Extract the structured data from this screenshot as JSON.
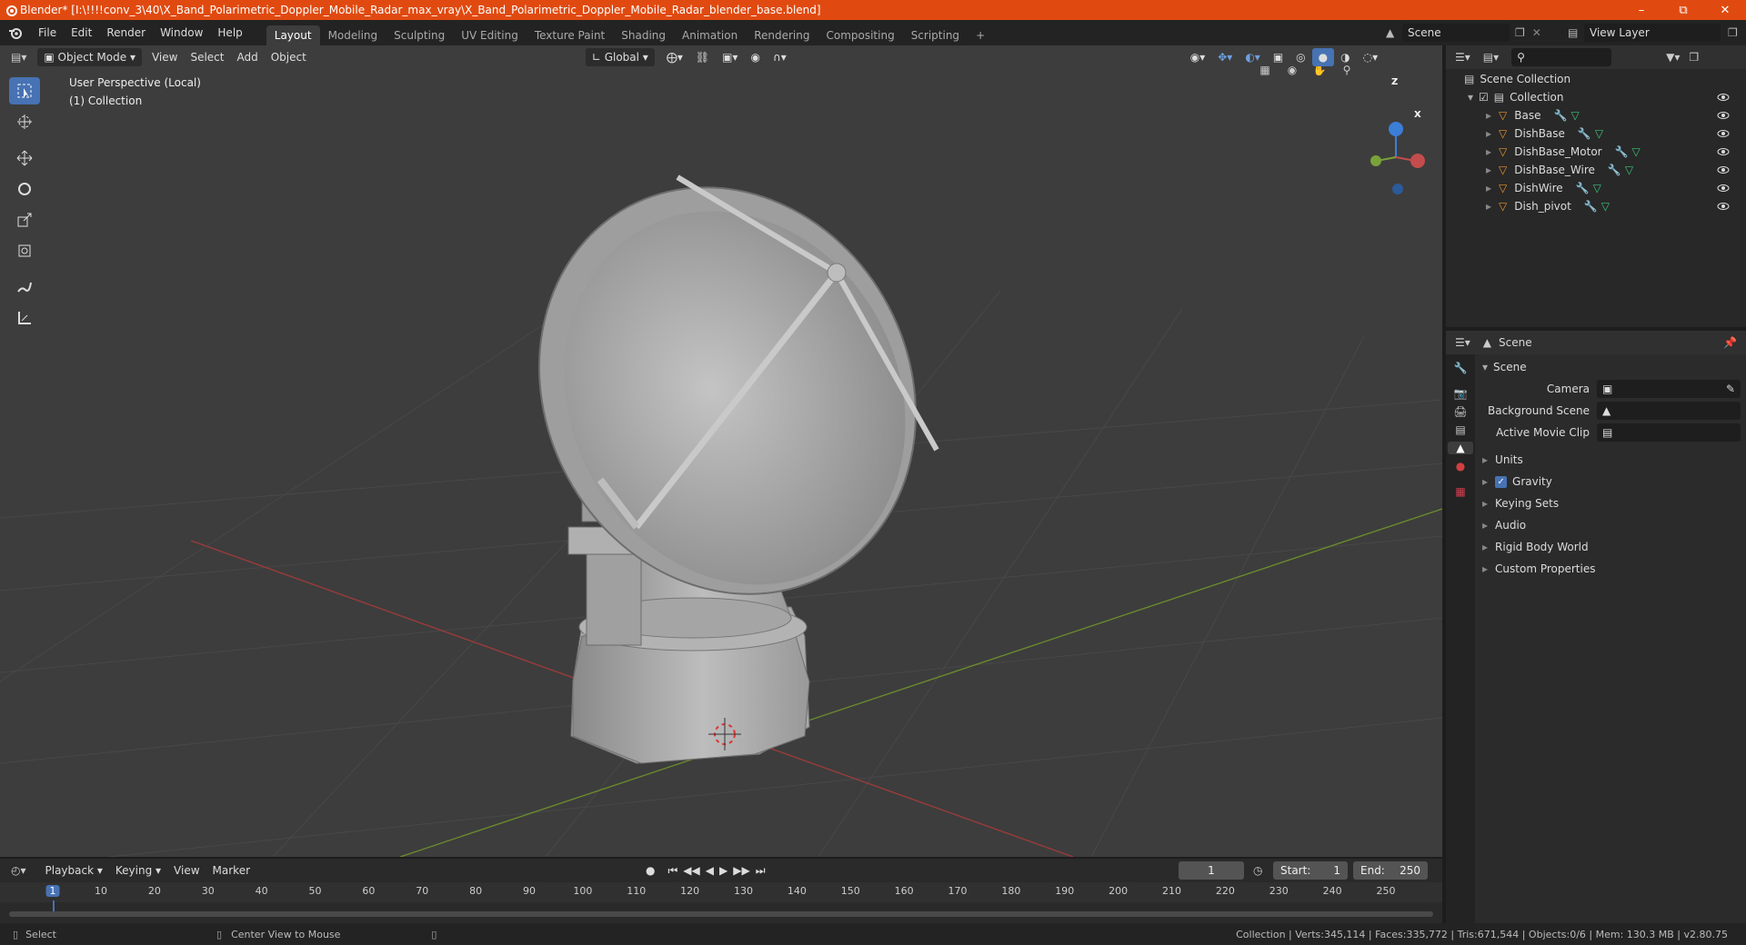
{
  "window": {
    "title": "Blender* [I:\\!!!!conv_3\\40\\X_Band_Polarimetric_Doppler_Mobile_Radar_max_vray\\X_Band_Polarimetric_Doppler_Mobile_Radar_blender_base.blend]"
  },
  "menubar": [
    "File",
    "Edit",
    "Render",
    "Window",
    "Help"
  ],
  "workspaces": [
    "Layout",
    "Modeling",
    "Sculpting",
    "UV Editing",
    "Texture Paint",
    "Shading",
    "Animation",
    "Rendering",
    "Compositing",
    "Scripting"
  ],
  "active_workspace": "Layout",
  "scene_selector": "Scene",
  "view_layer": "View Layer",
  "viewport": {
    "mode": "Object Mode",
    "menus": [
      "View",
      "Select",
      "Add",
      "Object"
    ],
    "orientation": "Global",
    "perspective_label": "User Perspective (Local)",
    "collection_label": "(1) Collection",
    "gizmo_axes": {
      "z": "Z",
      "x": "X"
    }
  },
  "outliner": {
    "root": "Scene Collection",
    "collection": "Collection",
    "objects": [
      "Base",
      "DishBase",
      "DishBase_Motor",
      "DishBase_Wire",
      "DishWire",
      "Dish_pivot"
    ]
  },
  "properties": {
    "header": "Scene",
    "section": "Scene",
    "fields": {
      "camera": "Camera",
      "background_scene": "Background Scene",
      "active_movie_clip": "Active Movie Clip"
    },
    "panels": [
      "Units",
      "Gravity",
      "Keying Sets",
      "Audio",
      "Rigid Body World",
      "Custom Properties"
    ]
  },
  "timeline": {
    "menus": [
      "Playback",
      "Keying",
      "View",
      "Marker"
    ],
    "current_frame": "1",
    "start_label": "Start:",
    "start": "1",
    "end_label": "End:",
    "end": "250",
    "ruler": [
      "1",
      "10",
      "20",
      "30",
      "40",
      "50",
      "60",
      "70",
      "80",
      "90",
      "100",
      "110",
      "120",
      "130",
      "140",
      "150",
      "160",
      "170",
      "180",
      "190",
      "200",
      "210",
      "220",
      "230",
      "240",
      "250"
    ]
  },
  "statusbar": {
    "left_action": "Select",
    "mid_action": "Center View to Mouse",
    "stats": "Collection | Verts:345,114 | Faces:335,772 | Tris:671,544 | Objects:0/6 | Mem: 130.3 MB | v2.80.75"
  },
  "colors": {
    "titlebar": "#e04a10",
    "accent": "#4772b3",
    "x_axis": "#c44c4c",
    "y_axis": "#7aa23a",
    "z_axis": "#3b7ed6"
  }
}
